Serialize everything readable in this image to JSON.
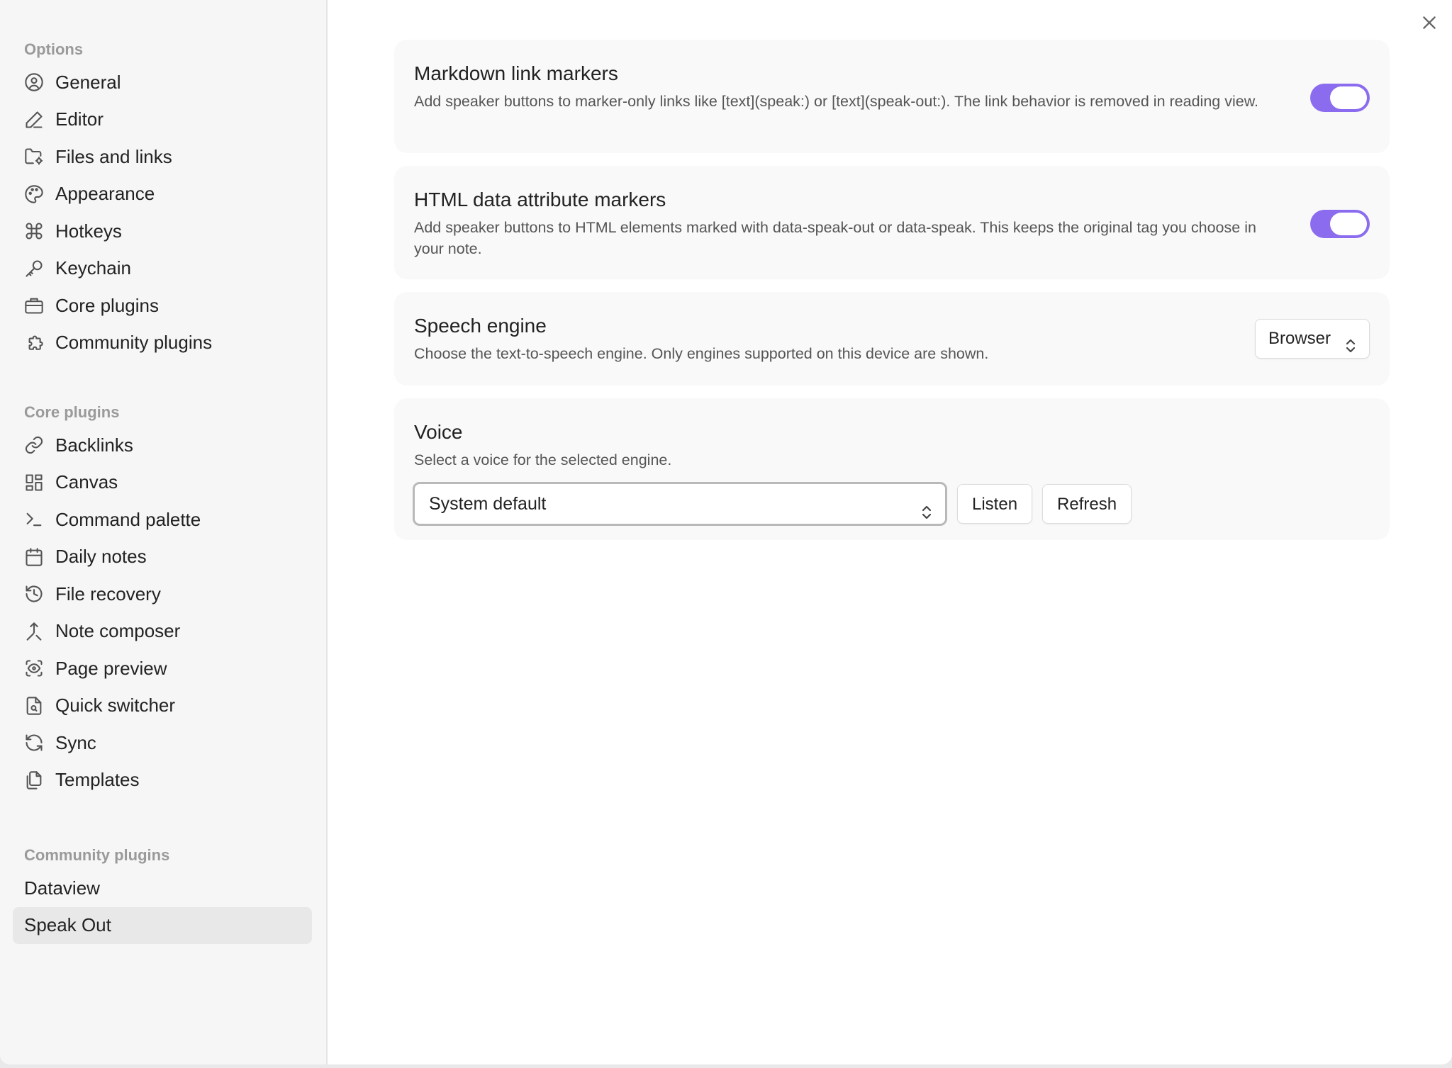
{
  "sidebar": {
    "options_label": "Options",
    "options": [
      {
        "label": "General",
        "icon": "user-circle-icon"
      },
      {
        "label": "Editor",
        "icon": "pencil-icon"
      },
      {
        "label": "Files and links",
        "icon": "folder-cog-icon"
      },
      {
        "label": "Appearance",
        "icon": "palette-icon"
      },
      {
        "label": "Hotkeys",
        "icon": "command-icon"
      },
      {
        "label": "Keychain",
        "icon": "key-icon"
      },
      {
        "label": "Core plugins",
        "icon": "briefcase-icon"
      },
      {
        "label": "Community plugins",
        "icon": "puzzle-icon"
      }
    ],
    "core_label": "Core plugins",
    "core": [
      {
        "label": "Backlinks",
        "icon": "link-icon"
      },
      {
        "label": "Canvas",
        "icon": "layout-grid-icon"
      },
      {
        "label": "Command palette",
        "icon": "terminal-icon"
      },
      {
        "label": "Daily notes",
        "icon": "calendar-icon"
      },
      {
        "label": "File recovery",
        "icon": "history-icon"
      },
      {
        "label": "Note composer",
        "icon": "merge-icon"
      },
      {
        "label": "Page preview",
        "icon": "eye-scan-icon"
      },
      {
        "label": "Quick switcher",
        "icon": "file-search-icon"
      },
      {
        "label": "Sync",
        "icon": "refresh-icon"
      },
      {
        "label": "Templates",
        "icon": "files-icon"
      }
    ],
    "community_label": "Community plugins",
    "community": [
      {
        "label": "Dataview"
      },
      {
        "label": "Speak Out",
        "active": true
      }
    ]
  },
  "settings": {
    "markdown": {
      "title": "Markdown link markers",
      "desc": "Add speaker buttons to marker-only links like [text](speak:) or [text](speak-out:). The link behavior is removed in reading view.",
      "enabled": true
    },
    "html": {
      "title": "HTML data attribute markers",
      "desc": "Add speaker buttons to HTML elements marked with data-speak-out or data-speak. This keeps the original tag you choose in your note.",
      "enabled": true
    },
    "engine": {
      "title": "Speech engine",
      "desc": "Choose the text-to-speech engine. Only engines supported on this device are shown.",
      "value": "Browser"
    },
    "voice": {
      "title": "Voice",
      "desc": "Select a voice for the selected engine.",
      "value": "System default",
      "listen_label": "Listen",
      "refresh_label": "Refresh"
    }
  },
  "colors": {
    "accent": "#8b6cef",
    "sidebar_bg": "#f6f6f6",
    "card_bg": "#f9f9f9"
  }
}
